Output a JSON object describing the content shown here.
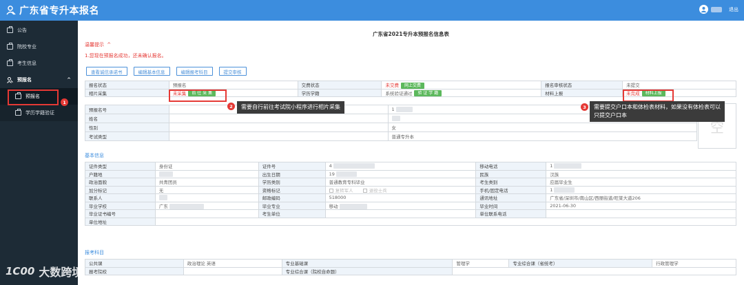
{
  "app": {
    "title": "广东省专升本报名",
    "logout_label": "退出"
  },
  "sidebar": {
    "items": [
      {
        "label": "公告"
      },
      {
        "label": "院校专业"
      },
      {
        "label": "考生信息"
      }
    ],
    "group": {
      "label": "预报名",
      "chevron": "^"
    },
    "sub_items": [
      {
        "label": "预报名"
      },
      {
        "label": "学历学籍验证"
      }
    ]
  },
  "annotations": {
    "badge1": "1",
    "badge2": "2",
    "badge3": "3",
    "tooltip2": "需要自行前往考试院小程序进行相片采集",
    "tooltip3_line1": "需要提交户口本和体检表材料，如果没有体检表可以",
    "tooltip3_line2": "只提交户口本"
  },
  "main": {
    "title": "广东省2021专升本预报名信息表",
    "tip_title": "温馨提示",
    "tip_chevron": "^",
    "tip_message": "1.您现在预报名成功，还未确认报名。",
    "actions": [
      "查看诚信承诺书",
      "编辑基本信息",
      "编辑报考科目",
      "提交审核"
    ],
    "status": {
      "row1": {
        "l1": "报名状态",
        "v1": "预报名",
        "l2": "交费状态",
        "v2": "未交费",
        "btn2": "网上交费",
        "l3": "报名审核状态",
        "v3": "未提交"
      },
      "row2": {
        "l1": "相片采集",
        "v1": "未采集",
        "btn1": "前 往 采 集",
        "l2": "学历学籍",
        "v2": "系统验证通过",
        "btn2": "验 证 学 籍",
        "l3": "材料上报",
        "v3": "未完成",
        "btn3": "材料上报"
      }
    },
    "identity": {
      "rows": [
        {
          "label": "预报名号",
          "value": "1"
        },
        {
          "label": "姓名",
          "value": ""
        },
        {
          "label": "性别",
          "value": "女"
        },
        {
          "label": "考试类型",
          "value": "普通专升本"
        }
      ],
      "photo_placeholder": "空"
    },
    "basic": {
      "section_title": "基本信息",
      "rows": [
        [
          "证件类型",
          "身份证",
          "证件号",
          "4",
          "移动电话",
          "1"
        ],
        [
          "户籍地",
          "",
          "出生日期",
          "19",
          "民族",
          "汉族"
        ],
        [
          "政治面貌",
          "共青团员",
          "学历类别",
          "普通教育专科毕业",
          "考生类别",
          "应届毕业生"
        ],
        [
          "加分标记",
          "无",
          "资格标记",
          "",
          "手机/固定电话",
          "1"
        ],
        [
          "联系人",
          "",
          "邮政编码",
          "518000",
          "通讯地址",
          "广东省/深圳市/南山区/西丽街道/旺棠大道206"
        ],
        [
          "毕业学校",
          "广东",
          "毕业专业",
          "移动",
          "毕业时间",
          "2021-06-30"
        ],
        [
          "毕业证书编号",
          "",
          "考生单位",
          "",
          "单位联系电话",
          ""
        ],
        [
          "单位地址",
          "",
          "",
          "",
          "",
          ""
        ]
      ],
      "checkbox1": "复转军人",
      "checkbox2": "退役士兵"
    },
    "subjects": {
      "section_title": "报考科目",
      "rows": [
        [
          "公共课",
          "政治理论 英语",
          "专业基础课",
          "管理学",
          "专业综合课（省统考）",
          "行政管理学"
        ],
        [
          "报考院校",
          "",
          "专业综合课（院校自命题）",
          "",
          "",
          ""
        ]
      ]
    }
  },
  "watermark": {
    "logo": "1C00",
    "text": "大数跨境"
  },
  "colors": {
    "header": "#3c8dde",
    "sidebar": "#1d2b36",
    "alert": "#e53935",
    "success": "#5cb85c"
  }
}
